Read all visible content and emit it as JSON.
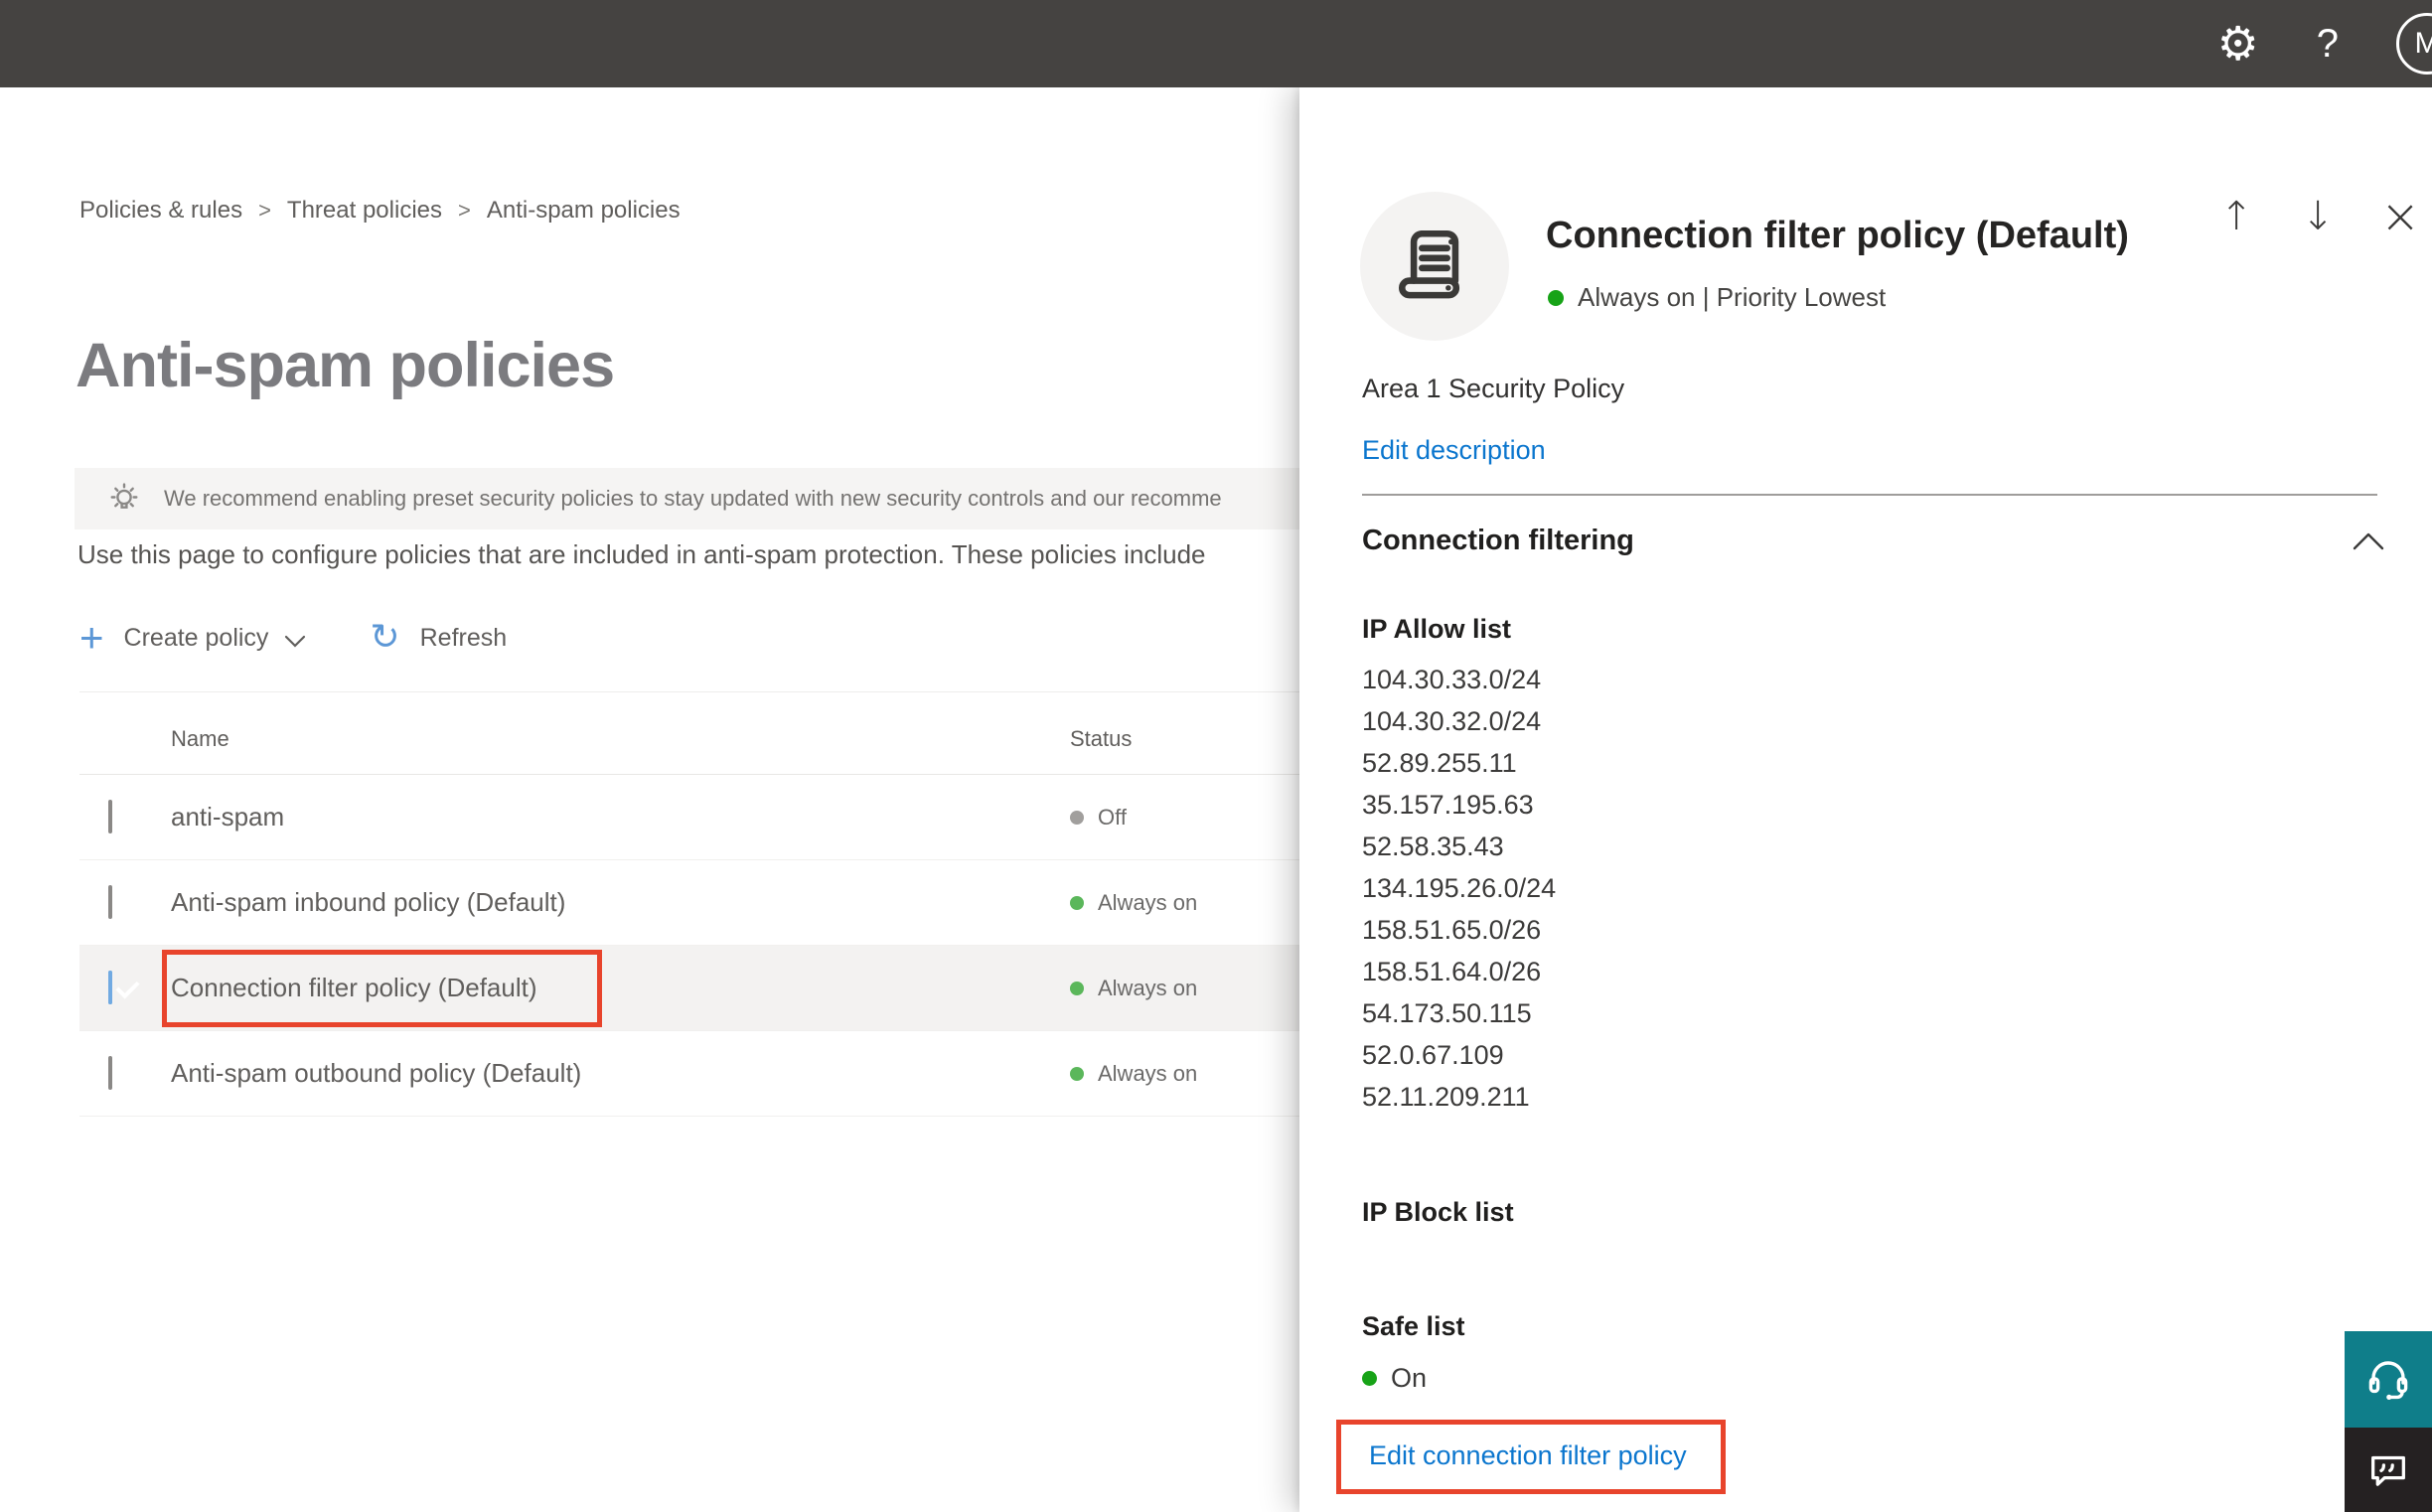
{
  "topbar": {
    "avatar_initial": "M"
  },
  "icons": {
    "settings": "⚙",
    "help": "?",
    "move_up": "↑",
    "move_down": "↓",
    "close": "×",
    "plus": "+",
    "refresh": "↻"
  },
  "breadcrumb": {
    "separator": ">",
    "items": [
      "Policies & rules",
      "Threat policies",
      "Anti-spam policies"
    ]
  },
  "page": {
    "title": "Anti-spam policies",
    "banner_text": "We recommend enabling preset security policies to stay updated with new security controls and our recomme",
    "description": "Use this page to configure policies that are included in anti-spam protection. These policies include",
    "create_policy_label": "Create policy",
    "refresh_label": "Refresh"
  },
  "table": {
    "columns": {
      "name": "Name",
      "status": "Status"
    },
    "rows": [
      {
        "name": "anti-spam",
        "status": "Off",
        "checked": false,
        "selected": false
      },
      {
        "name": "Anti-spam inbound policy (Default)",
        "status": "Always on",
        "checked": false,
        "selected": false
      },
      {
        "name": "Connection filter policy (Default)",
        "status": "Always on",
        "checked": true,
        "selected": true
      },
      {
        "name": "Anti-spam outbound policy (Default)",
        "status": "Always on",
        "checked": false,
        "selected": false
      }
    ]
  },
  "flyout": {
    "title": "Connection filter policy (Default)",
    "status_text": "Always on | Priority Lowest",
    "description": "Area 1 Security Policy",
    "edit_description_label": "Edit description",
    "section_title": "Connection filtering",
    "ip_allow_title": "IP Allow list",
    "ip_allow_items": [
      "104.30.33.0/24",
      "104.30.32.0/24",
      "52.89.255.11",
      "35.157.195.63",
      "52.58.35.43",
      "134.195.26.0/24",
      "158.51.65.0/26",
      "158.51.64.0/26",
      "54.173.50.115",
      "52.0.67.109",
      "52.11.209.211"
    ],
    "ip_block_title": "IP Block list",
    "safe_list_title": "Safe list",
    "safe_list_status": "On",
    "edit_policy_label": "Edit connection filter policy"
  },
  "colors": {
    "topbar_bg": "#454341",
    "accent_blue": "#0b76ce",
    "annotation_red": "#e8442c",
    "status_green": "#17a317",
    "status_off_gray": "#a19f9d",
    "checkbox_checked_blue": "#71aae2",
    "selected_row_bg": "#f3f2f1",
    "help_button_teal": "#0f7e8a",
    "feedback_button_dark": "#252122"
  }
}
